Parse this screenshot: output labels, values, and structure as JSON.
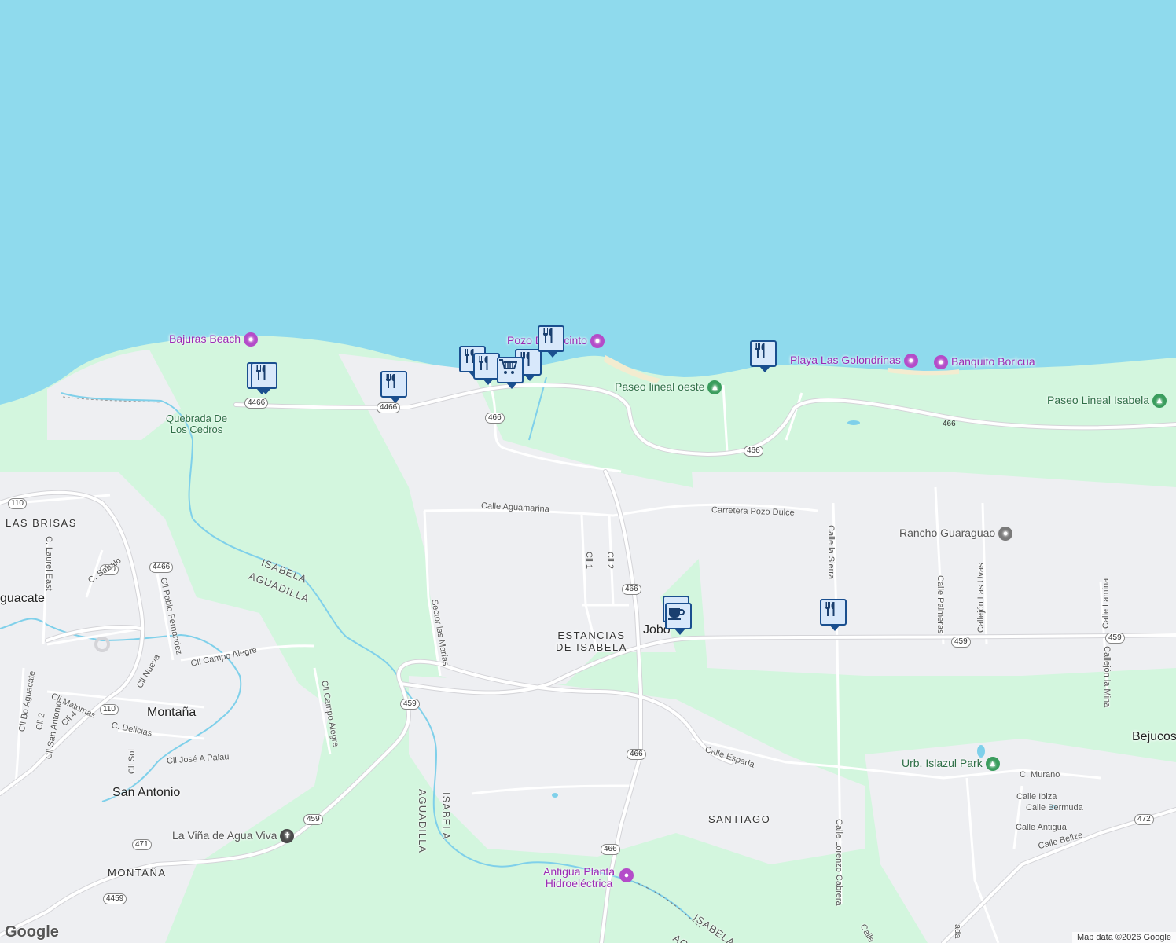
{
  "labels": {
    "bajuras_beach": "Bajuras Beach",
    "pozo_de_jacinto": "Pozo De Jacinto",
    "paseo_lineal_oeste": "Paseo lineal oeste",
    "playa_las_golondrinas": "Playa Las Golondrinas",
    "banquito_boricua": "Banquito Boricua",
    "paseo_lineal_isabela": "Paseo Lineal Isabela",
    "quebrada_de_los_cedros_1": "Quebrada De",
    "quebrada_de_los_cedros_2": "Los Cedros",
    "rancho_guaraguao": "Rancho Guaraguao",
    "las_brisas": "LAS BRISAS",
    "aguacate": "guacate",
    "jobos": "Jobo",
    "estancias_1": "ESTANCIAS",
    "estancias_2": "DE ISABELA",
    "montana_town": "Montaña",
    "montana_area": "MONTAÑA",
    "san_antonio": "San Antonio",
    "santiago": "SANTIAGO",
    "bejucos": "Bejucos",
    "la_vina": "La Viña de Agua Viva",
    "urb_islazul": "Urb. Islazul Park",
    "antigua_planta_1": "Antigua Planta",
    "antigua_planta_2": "Hidroeléctrica",
    "isabela_1": "ISABELA",
    "aguadilla_1": "AGUADILLA",
    "aguadilla_2": "AGUADILLA",
    "isabela_2": "ISABELA",
    "isabela_3": "ISABELA",
    "aguadilla_3": "AGU"
  },
  "streets": {
    "calle_aguamarina": "Calle Aguamarina",
    "carretera_pozo_dulce": "Carretera Pozo Dulce",
    "calle_la_sierra": "Calle la Sierra",
    "calle_palmeras": "Calle Palmeras",
    "callejon_las_uvas": "Callejón Las Uvas",
    "calle_lamina": "Calle Lamina",
    "callejon_la_mina": "Callejón la Mina",
    "cll_1": "Cll 1",
    "cll_2": "Cll 2",
    "sector_las_marias": "Sector las Marías",
    "cll_pablo_fernandez": "Cll Pablo Fernandez",
    "cll_campo_alegre_1": "Cll Campo Alegre",
    "cll_campo_alegre_2": "Cll Campo Alegre",
    "c_laurel_east": "C. Laurel East",
    "c_sabalo": "C. Sabalo",
    "cll_matomas": "Cll Matomas",
    "cll_nueva": "Cll Nueva",
    "c_delicias": "C. Delicias",
    "cll_bo_aguacate": "Cll Bo Aguacate",
    "cll_2_west": "Cll 2",
    "cll_san_antonio": "Cll San Antonio",
    "cll_4": "Cll 4",
    "cll_sol": "Cll Sol",
    "cll_jose_a_palau": "Cll José A Palau",
    "calle_espada": "Calle Espada",
    "calle_lorenzo_cabrera": "Calle Lorenzo Cabrera",
    "c_murano": "C. Murano",
    "calle_ibiza": "Calle Ibiza",
    "calle_bermuda": "Calle Bermuda",
    "calle_antigua": "Calle Antigua",
    "calle_belize": "Calle Belize",
    "calle_bottom": "Calle",
    "bottom_fragment": "ada"
  },
  "shields": [
    {
      "id": "r4466-a",
      "text": "4466"
    },
    {
      "id": "r4466-b",
      "text": "4466"
    },
    {
      "id": "r466-a",
      "text": "466"
    },
    {
      "id": "r466-b",
      "text": "466"
    },
    {
      "id": "r466-c",
      "text": "466"
    },
    {
      "id": "r466-d",
      "text": "466"
    },
    {
      "id": "r466-e",
      "text": "466"
    },
    {
      "id": "r466-f",
      "text": "466"
    },
    {
      "id": "r110-a",
      "text": "110"
    },
    {
      "id": "r110-b",
      "text": "110"
    },
    {
      "id": "r110-c",
      "text": "110"
    },
    {
      "id": "r4466-c",
      "text": "4466"
    },
    {
      "id": "r459-a",
      "text": "459"
    },
    {
      "id": "r459-b",
      "text": "459"
    },
    {
      "id": "r459-c",
      "text": "459"
    },
    {
      "id": "r459-d",
      "text": "459"
    },
    {
      "id": "r471",
      "text": "471"
    },
    {
      "id": "r4459",
      "text": "4459"
    },
    {
      "id": "r472",
      "text": "472"
    }
  ],
  "markers": [
    {
      "id": "restaurant-bajuras-1",
      "icon": "restaurant-icon"
    },
    {
      "id": "restaurant-bajuras-2",
      "icon": "restaurant-icon"
    },
    {
      "id": "restaurant-4466",
      "icon": "restaurant-icon"
    },
    {
      "id": "restaurant-pozo-1",
      "icon": "restaurant-icon"
    },
    {
      "id": "restaurant-pozo-2",
      "icon": "restaurant-icon"
    },
    {
      "id": "restaurant-pozo-3",
      "icon": "restaurant-icon"
    },
    {
      "id": "shopping-pozo",
      "icon": "shopping-cart-icon"
    },
    {
      "id": "restaurant-pozo-top",
      "icon": "restaurant-icon"
    },
    {
      "id": "restaurant-golondrinas",
      "icon": "restaurant-icon"
    },
    {
      "id": "cafe-jobos",
      "icon": "coffee-cup-icon"
    },
    {
      "id": "restaurant-la-sierra",
      "icon": "restaurant-icon"
    }
  ],
  "attribution": {
    "logo": "Google",
    "text": "Map data ©2026 Google"
  },
  "colors": {
    "water": "#9ce0ee",
    "land": "#d4f5de",
    "urban": "#f1f1f3",
    "road": "#ffffff",
    "road_outline": "#d0d0d4",
    "poi_purple": "#9c2bb5",
    "marker_border": "#1a4f8f",
    "marker_fill": "#d8e8fb"
  }
}
